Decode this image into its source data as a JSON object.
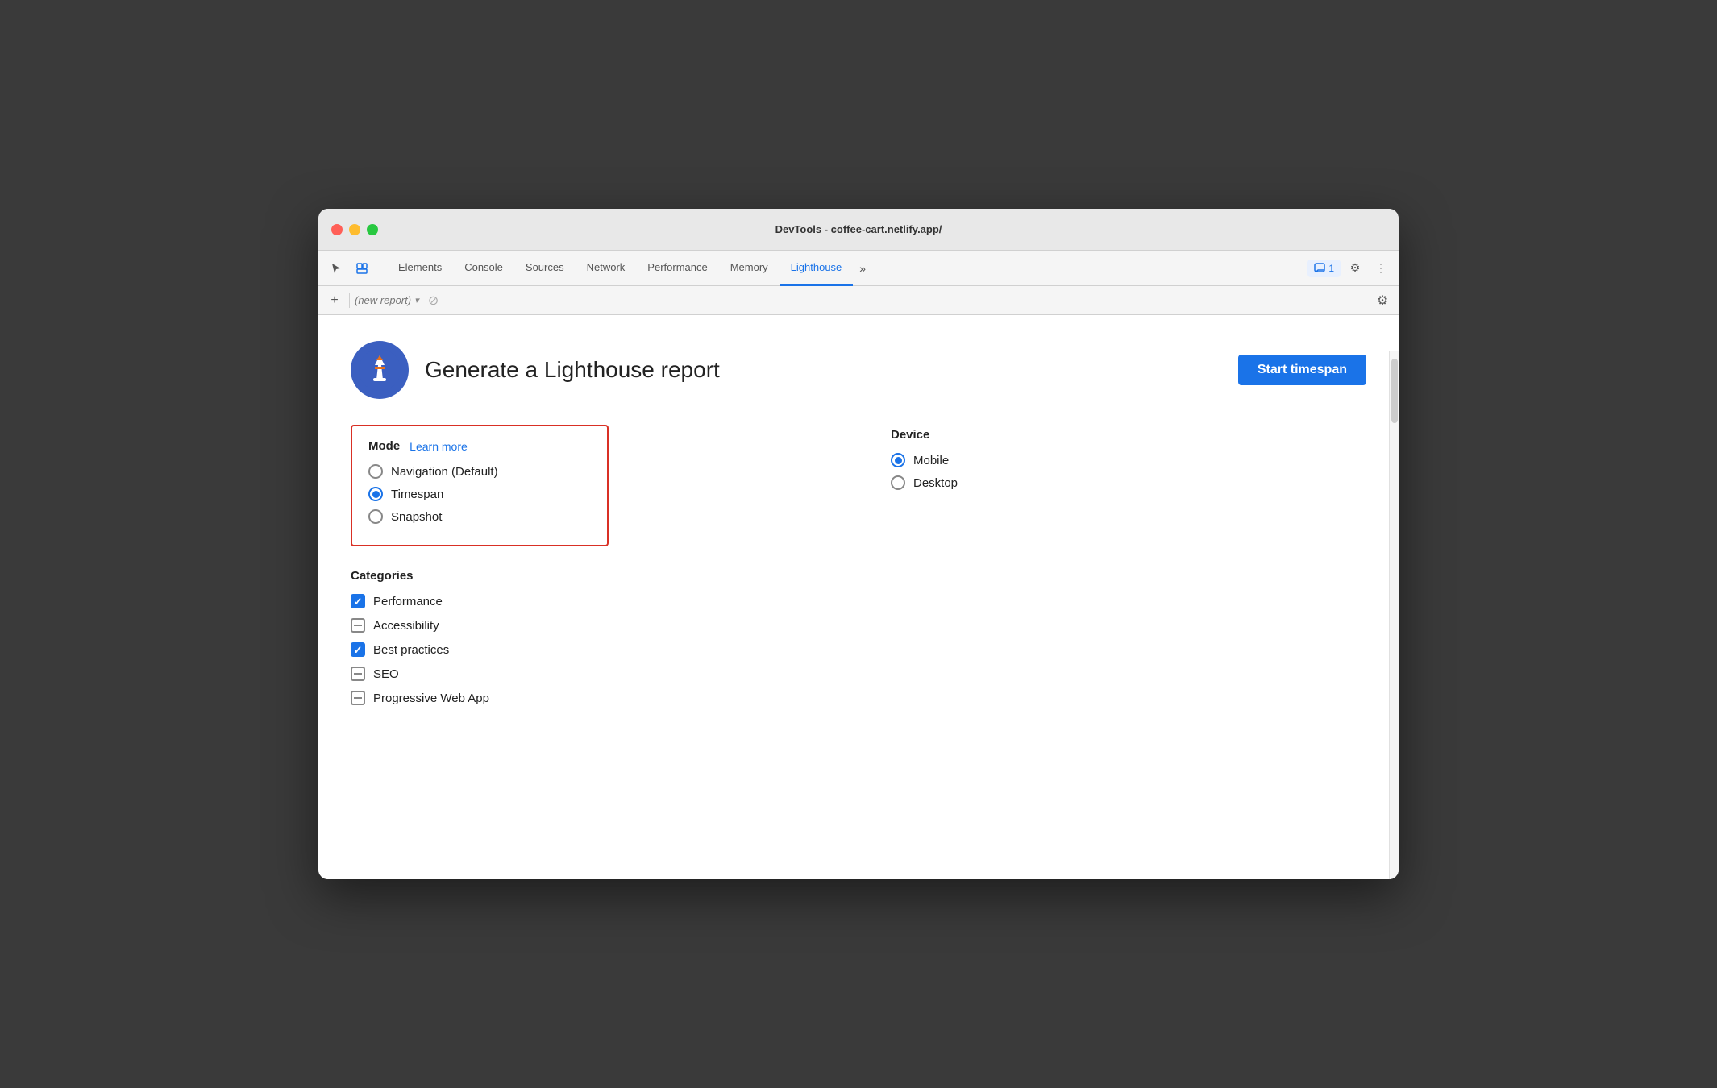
{
  "window": {
    "title": "DevTools - coffee-cart.netlify.app/"
  },
  "tabs": [
    {
      "id": "elements",
      "label": "Elements",
      "active": false
    },
    {
      "id": "console",
      "label": "Console",
      "active": false
    },
    {
      "id": "sources",
      "label": "Sources",
      "active": false
    },
    {
      "id": "network",
      "label": "Network",
      "active": false
    },
    {
      "id": "performance",
      "label": "Performance",
      "active": false
    },
    {
      "id": "memory",
      "label": "Memory",
      "active": false
    },
    {
      "id": "lighthouse",
      "label": "Lighthouse",
      "active": true
    }
  ],
  "toolbar": {
    "more_label": "»",
    "badge_count": "1",
    "settings_icon": "⚙",
    "more_icon": "⋮"
  },
  "subtoolbar": {
    "add_icon": "+",
    "report_placeholder": "(new report)",
    "dropdown_icon": "▾",
    "cancel_icon": "⊘",
    "settings_icon": "⚙"
  },
  "header": {
    "title": "Generate a Lighthouse report",
    "start_button": "Start timespan"
  },
  "mode": {
    "label": "Mode",
    "learn_more": "Learn more",
    "options": [
      {
        "id": "navigation",
        "label": "Navigation (Default)",
        "selected": false
      },
      {
        "id": "timespan",
        "label": "Timespan",
        "selected": true
      },
      {
        "id": "snapshot",
        "label": "Snapshot",
        "selected": false
      }
    ]
  },
  "device": {
    "label": "Device",
    "options": [
      {
        "id": "mobile",
        "label": "Mobile",
        "selected": true
      },
      {
        "id": "desktop",
        "label": "Desktop",
        "selected": false
      }
    ]
  },
  "categories": {
    "label": "Categories",
    "items": [
      {
        "id": "performance",
        "label": "Performance",
        "state": "checked"
      },
      {
        "id": "accessibility",
        "label": "Accessibility",
        "state": "indeterminate"
      },
      {
        "id": "best-practices",
        "label": "Best practices",
        "state": "checked"
      },
      {
        "id": "seo",
        "label": "SEO",
        "state": "indeterminate"
      },
      {
        "id": "pwa",
        "label": "Progressive Web App",
        "state": "indeterminate"
      }
    ]
  }
}
